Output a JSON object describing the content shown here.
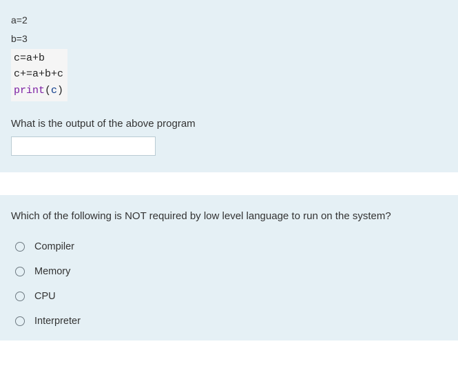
{
  "q1": {
    "intro_lines": [
      "a=2",
      "b=3"
    ],
    "code_lines": [
      {
        "plain": "c=a+b"
      },
      {
        "plain": "c+=a+b+c"
      },
      {
        "print_call": true,
        "fn": "print",
        "arg": "c"
      }
    ],
    "prompt": "What is the output of the above program",
    "answer_value": ""
  },
  "q2": {
    "prompt": "Which of the following is NOT required by low level language to run on the system?",
    "options": [
      "Compiler",
      "Memory",
      "CPU",
      "Interpreter"
    ]
  }
}
